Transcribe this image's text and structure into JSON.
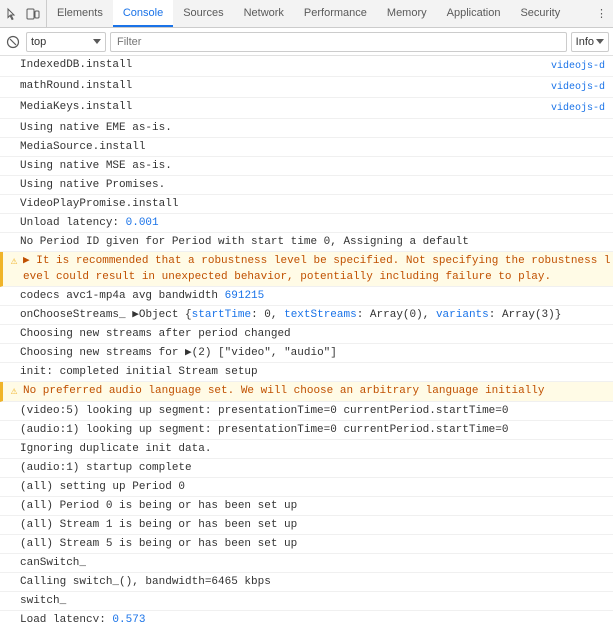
{
  "tabs": [
    {
      "id": "elements",
      "label": "Elements",
      "active": false
    },
    {
      "id": "console",
      "label": "Console",
      "active": true
    },
    {
      "id": "sources",
      "label": "Sources",
      "active": false
    },
    {
      "id": "network",
      "label": "Network",
      "active": false
    },
    {
      "id": "performance",
      "label": "Performance",
      "active": false
    },
    {
      "id": "memory",
      "label": "Memory",
      "active": false
    },
    {
      "id": "application",
      "label": "Application",
      "active": false
    },
    {
      "id": "security",
      "label": "Security",
      "active": false
    }
  ],
  "toolbar": {
    "dropdown_value": "top",
    "filter_placeholder": "Filter",
    "info_label": "Info"
  },
  "log_entries": [
    {
      "id": 1,
      "type": "normal",
      "text": "IndexedDB.install",
      "source": "videojs-d"
    },
    {
      "id": 2,
      "type": "normal",
      "text": "mathRound.install",
      "source": "videojs-d"
    },
    {
      "id": 3,
      "type": "normal",
      "text": "MediaKeys.install",
      "source": "videojs-d"
    },
    {
      "id": 4,
      "type": "normal",
      "text": "Using native EME as-is.",
      "source": ""
    },
    {
      "id": 5,
      "type": "normal",
      "text": "MediaSource.install",
      "source": ""
    },
    {
      "id": 6,
      "type": "normal",
      "text": "Using native MSE as-is.",
      "source": ""
    },
    {
      "id": 7,
      "type": "normal",
      "text": "Using native Promises.",
      "source": ""
    },
    {
      "id": 8,
      "type": "normal",
      "text": "VideoPlayPromise.install",
      "source": ""
    },
    {
      "id": 9,
      "type": "normal",
      "text": "Unload latency: ",
      "link_text": "0.001",
      "source": ""
    },
    {
      "id": 10,
      "type": "normal",
      "text": "No Period ID given for Period with start time 0,  Assigning a default",
      "source": ""
    },
    {
      "id": 11,
      "type": "warning",
      "text": "It is recommended that a robustness level be specified. Not specifying the robustness level could result in unexpected behavior, potentially including failure to play.",
      "source": ""
    },
    {
      "id": 12,
      "type": "normal",
      "text": "codecs avc1-mp4a avg bandwidth ",
      "link_text": "691215",
      "source": ""
    },
    {
      "id": 13,
      "type": "normal",
      "text": "onChooseStreams_ ▶Object {startTime: 0, textStreams: Array(0), variants: Array(3)}",
      "source": ""
    },
    {
      "id": 14,
      "type": "normal",
      "text": "Choosing new streams after period changed",
      "source": ""
    },
    {
      "id": 15,
      "type": "normal",
      "text": "Choosing new streams for ▶(2) [\"video\", \"audio\"]",
      "source": ""
    },
    {
      "id": 16,
      "type": "normal",
      "text": "init: completed initial Stream setup",
      "source": ""
    },
    {
      "id": 17,
      "type": "warning",
      "text": "No preferred audio language set.  We will choose an arbitrary language initially",
      "source": ""
    },
    {
      "id": 18,
      "type": "normal",
      "text": "(video:5) looking up segment: presentationTime=0 currentPeriod.startTime=0",
      "source": ""
    },
    {
      "id": 19,
      "type": "normal",
      "text": "(audio:1) looking up segment: presentationTime=0 currentPeriod.startTime=0",
      "source": ""
    },
    {
      "id": 20,
      "type": "normal",
      "text": "Ignoring duplicate init data.",
      "source": ""
    },
    {
      "id": 21,
      "type": "normal",
      "text": "(audio:1) startup complete",
      "source": ""
    },
    {
      "id": 22,
      "type": "normal",
      "text": "(all) setting up Period 0",
      "source": ""
    },
    {
      "id": 23,
      "type": "normal",
      "text": "(all) Period 0 is being or has been set up",
      "source": ""
    },
    {
      "id": 24,
      "type": "normal",
      "text": "(all) Stream 1 is being or has been set up",
      "source": ""
    },
    {
      "id": 25,
      "type": "normal",
      "text": "(all) Stream 5 is being or has been set up",
      "source": ""
    },
    {
      "id": 26,
      "type": "normal",
      "text": "canSwitch_",
      "source": ""
    },
    {
      "id": 27,
      "type": "normal",
      "text": "Calling switch_(), bandwidth=6465 kbps",
      "source": ""
    },
    {
      "id": 28,
      "type": "normal",
      "text": "switch_",
      "source": ""
    },
    {
      "id": 29,
      "type": "normal",
      "text": "Load latency: ",
      "link_text": "0.573",
      "source": ""
    }
  ]
}
